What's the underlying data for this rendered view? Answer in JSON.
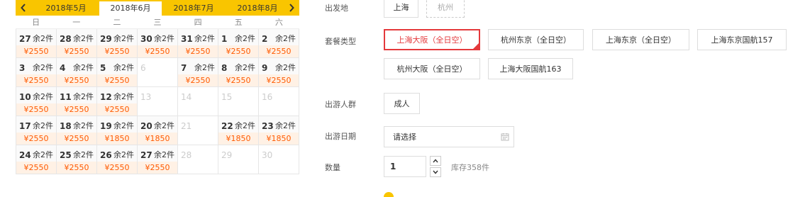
{
  "calendar": {
    "months": [
      "2018年5月",
      "2018年6月",
      "2018年7月",
      "2018年8月"
    ],
    "active_month_index": 1,
    "weekdays": [
      "日",
      "一",
      "二",
      "三",
      "四",
      "五",
      "六"
    ],
    "weeks": [
      [
        {
          "day": "27",
          "stock": "余2件",
          "price": "¥2550"
        },
        {
          "day": "28",
          "stock": "余2件",
          "price": "¥2550"
        },
        {
          "day": "29",
          "stock": "余2件",
          "price": "¥2550"
        },
        {
          "day": "30",
          "stock": "余2件",
          "price": "¥2550"
        },
        {
          "day": "31",
          "stock": "余2件",
          "price": "¥2550"
        },
        {
          "day": "1",
          "stock": "余2件",
          "price": "¥2550"
        },
        {
          "day": "2",
          "stock": "余2件",
          "price": "¥2550"
        }
      ],
      [
        {
          "day": "3",
          "stock": "余2件",
          "price": "¥2550"
        },
        {
          "day": "4",
          "stock": "余2件",
          "price": "¥2550"
        },
        {
          "day": "5",
          "stock": "余2件",
          "price": "¥2550"
        },
        {
          "day": "6",
          "stock": "",
          "price": ""
        },
        {
          "day": "7",
          "stock": "余2件",
          "price": "¥2550"
        },
        {
          "day": "8",
          "stock": "余2件",
          "price": "¥2550"
        },
        {
          "day": "9",
          "stock": "余2件",
          "price": "¥2550"
        }
      ],
      [
        {
          "day": "10",
          "stock": "余2件",
          "price": "¥2550"
        },
        {
          "day": "11",
          "stock": "余2件",
          "price": "¥2550"
        },
        {
          "day": "12",
          "stock": "余2件",
          "price": "¥2550"
        },
        {
          "day": "13",
          "stock": "",
          "price": ""
        },
        {
          "day": "14",
          "stock": "",
          "price": ""
        },
        {
          "day": "15",
          "stock": "",
          "price": ""
        },
        {
          "day": "16",
          "stock": "",
          "price": ""
        }
      ],
      [
        {
          "day": "17",
          "stock": "余2件",
          "price": "¥2550"
        },
        {
          "day": "18",
          "stock": "余2件",
          "price": "¥2550"
        },
        {
          "day": "19",
          "stock": "余2件",
          "price": "¥1850"
        },
        {
          "day": "20",
          "stock": "余2件",
          "price": "¥1850"
        },
        {
          "day": "21",
          "stock": "",
          "price": ""
        },
        {
          "day": "22",
          "stock": "余2件",
          "price": "¥1850"
        },
        {
          "day": "23",
          "stock": "余2件",
          "price": "¥1850"
        }
      ],
      [
        {
          "day": "24",
          "stock": "余2件",
          "price": "¥2550"
        },
        {
          "day": "25",
          "stock": "余2件",
          "price": "¥2550"
        },
        {
          "day": "26",
          "stock": "余2件",
          "price": "¥2550"
        },
        {
          "day": "27",
          "stock": "余2件",
          "price": "¥2550"
        },
        {
          "day": "28",
          "stock": "",
          "price": ""
        },
        {
          "day": "29",
          "stock": "",
          "price": ""
        },
        {
          "day": "30",
          "stock": "",
          "price": ""
        }
      ]
    ]
  },
  "form": {
    "departure": {
      "label": "出发地",
      "options": [
        "上海",
        "杭州"
      ]
    },
    "package": {
      "label": "套餐类型",
      "options": [
        "上海大阪（全日空）",
        "杭州东京（全日空）",
        "上海东京（全日空）",
        "上海东京国航157",
        "杭州大阪（全日空）",
        "上海大阪国航163"
      ]
    },
    "crowd": {
      "label": "出游人群",
      "options": [
        "成人"
      ]
    },
    "date": {
      "label": "出游日期",
      "placeholder": "请选择"
    },
    "quantity": {
      "label": "数量",
      "value": "1",
      "stock_text": "库存358件"
    }
  },
  "colors": {
    "accent": "#f9c500",
    "price": "#ff5a00",
    "selected": "#e4393c"
  }
}
